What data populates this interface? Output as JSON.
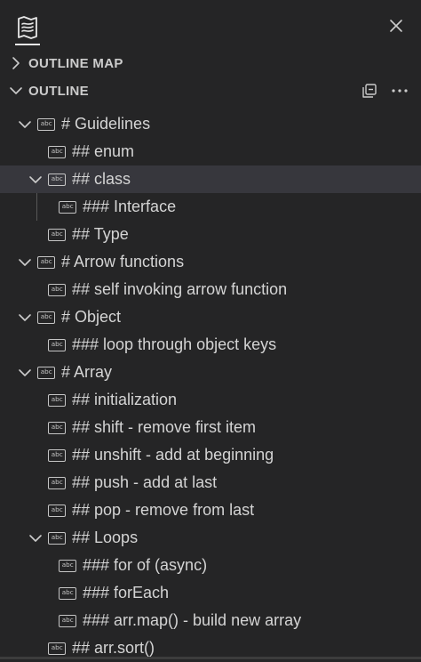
{
  "panel": {
    "sections": {
      "outline_map": {
        "title": "OUTLINE MAP",
        "expanded": false
      },
      "outline": {
        "title": "OUTLINE",
        "expanded": true
      }
    }
  },
  "tree": [
    {
      "label": "# Guidelines",
      "depth": 0,
      "state": "expanded",
      "selected": false
    },
    {
      "label": "## enum",
      "depth": 1,
      "state": "leaf",
      "selected": false
    },
    {
      "label": "## class",
      "depth": 1,
      "state": "expanded",
      "selected": true
    },
    {
      "label": "### Interface",
      "depth": 2,
      "state": "leaf",
      "selected": false
    },
    {
      "label": "## Type",
      "depth": 1,
      "state": "leaf",
      "selected": false
    },
    {
      "label": "# Arrow functions",
      "depth": 0,
      "state": "expanded",
      "selected": false
    },
    {
      "label": "## self invoking arrow function",
      "depth": 1,
      "state": "leaf",
      "selected": false
    },
    {
      "label": "# Object",
      "depth": 0,
      "state": "expanded",
      "selected": false
    },
    {
      "label": "### loop through object keys",
      "depth": 1,
      "state": "leaf",
      "selected": false
    },
    {
      "label": "# Array",
      "depth": 0,
      "state": "expanded",
      "selected": false
    },
    {
      "label": "## initialization",
      "depth": 1,
      "state": "leaf",
      "selected": false
    },
    {
      "label": "## shift - remove first item",
      "depth": 1,
      "state": "leaf",
      "selected": false
    },
    {
      "label": "## unshift - add at beginning",
      "depth": 1,
      "state": "leaf",
      "selected": false
    },
    {
      "label": "## push - add at last",
      "depth": 1,
      "state": "leaf",
      "selected": false
    },
    {
      "label": "## pop - remove from last",
      "depth": 1,
      "state": "leaf",
      "selected": false
    },
    {
      "label": "## Loops",
      "depth": 1,
      "state": "expanded",
      "selected": false
    },
    {
      "label": "### for of (async)",
      "depth": 2,
      "state": "leaf",
      "selected": false
    },
    {
      "label": "### forEach",
      "depth": 2,
      "state": "leaf",
      "selected": false
    },
    {
      "label": "### arr.map() - build new array",
      "depth": 2,
      "state": "leaf",
      "selected": false
    },
    {
      "label": "## arr.sort()",
      "depth": 1,
      "state": "leaf",
      "selected": false
    }
  ],
  "symbol_icon_text": "abc",
  "icons": {
    "app": "map-icon",
    "close": "close-icon",
    "collapse_all": "collapse-all-icon",
    "more": "more-actions-icon"
  },
  "colors": {
    "background": "#252526",
    "selection": "#37373d",
    "text": "#d4d4d4"
  }
}
